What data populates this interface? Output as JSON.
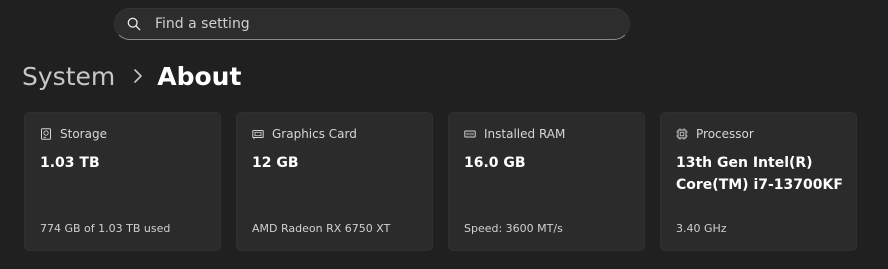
{
  "search": {
    "placeholder": "Find a setting",
    "icon": "search-icon"
  },
  "breadcrumb": {
    "parent": "System",
    "separator_icon": "chevron-right-icon",
    "current": "About"
  },
  "cards": [
    {
      "title": "Storage",
      "icon": "storage-icon",
      "value": "1.03 TB",
      "detail": "774 GB of 1.03 TB used"
    },
    {
      "title": "Graphics Card",
      "icon": "graphics-card-icon",
      "value": "12 GB",
      "detail": "AMD Radeon RX 6750 XT"
    },
    {
      "title": "Installed RAM",
      "icon": "ram-icon",
      "value": "16.0 GB",
      "detail": "Speed: 3600 MT/s"
    },
    {
      "title": "Processor",
      "icon": "processor-icon",
      "value": "13th Gen Intel(R) Core(TM) i7-13700KF",
      "detail": "3.40 GHz"
    }
  ],
  "colors": {
    "background": "#202020",
    "card": "#2b2b2b",
    "search_box": "#2d2d2d"
  }
}
